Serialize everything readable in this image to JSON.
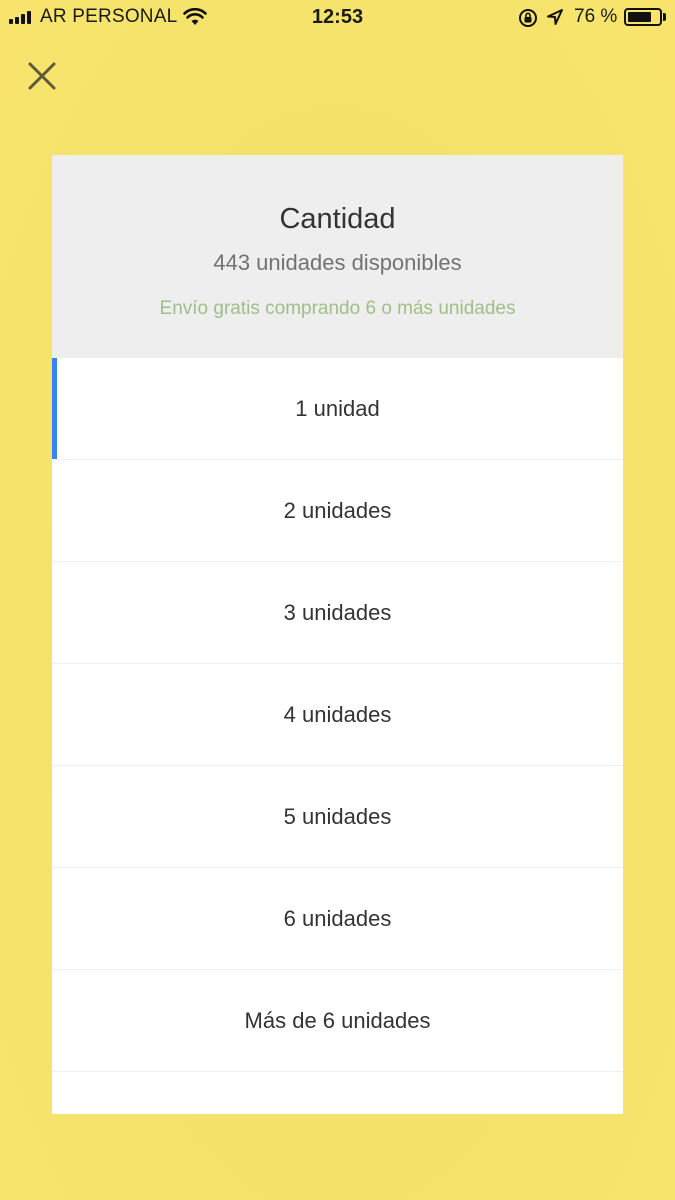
{
  "status_bar": {
    "carrier": "AR PERSONAL",
    "time": "12:53",
    "battery_percent": "76 %",
    "battery_level": 0.76
  },
  "close_icon": "close-icon",
  "colors": {
    "background": "#f6e36c",
    "header_bg": "#eeeeee",
    "accent_selected": "#3483fa",
    "shipping_text": "#9fbf87"
  },
  "quantity_dialog": {
    "title": "Cantidad",
    "available": "443 unidades disponibles",
    "shipping_note": "Envío gratis comprando 6 o más unidades",
    "options": [
      {
        "label": "1 unidad",
        "selected": true
      },
      {
        "label": "2 unidades",
        "selected": false
      },
      {
        "label": "3 unidades",
        "selected": false
      },
      {
        "label": "4 unidades",
        "selected": false
      },
      {
        "label": "5 unidades",
        "selected": false
      },
      {
        "label": "6 unidades",
        "selected": false
      },
      {
        "label": "Más de 6 unidades",
        "selected": false
      }
    ]
  }
}
